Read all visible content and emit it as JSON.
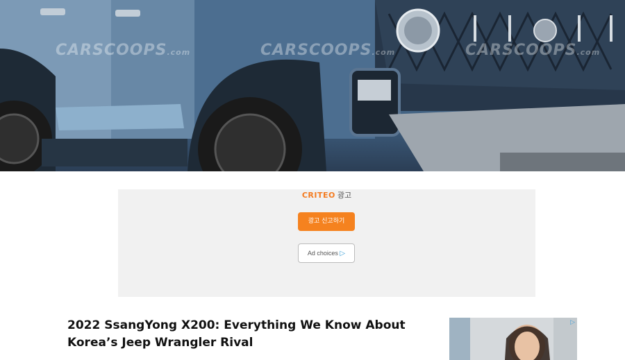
{
  "hero": {
    "watermark": "CARSCOOPS",
    "watermark_suffix": ".com"
  },
  "ad": {
    "brand": "CRITEO",
    "brand_suffix": "광고",
    "report_button": "광고 신고하기",
    "adchoices_label": "Ad choices",
    "adchoices_icon": "adchoices-icon"
  },
  "article": {
    "title": "2022 SsangYong X200: Everything We Know About Korea’s Jeep Wrangler Rival"
  },
  "colors": {
    "accent_orange": "#f5821f",
    "criteo_orange": "#f47b20",
    "adchoices_blue": "#3aa0d8"
  }
}
